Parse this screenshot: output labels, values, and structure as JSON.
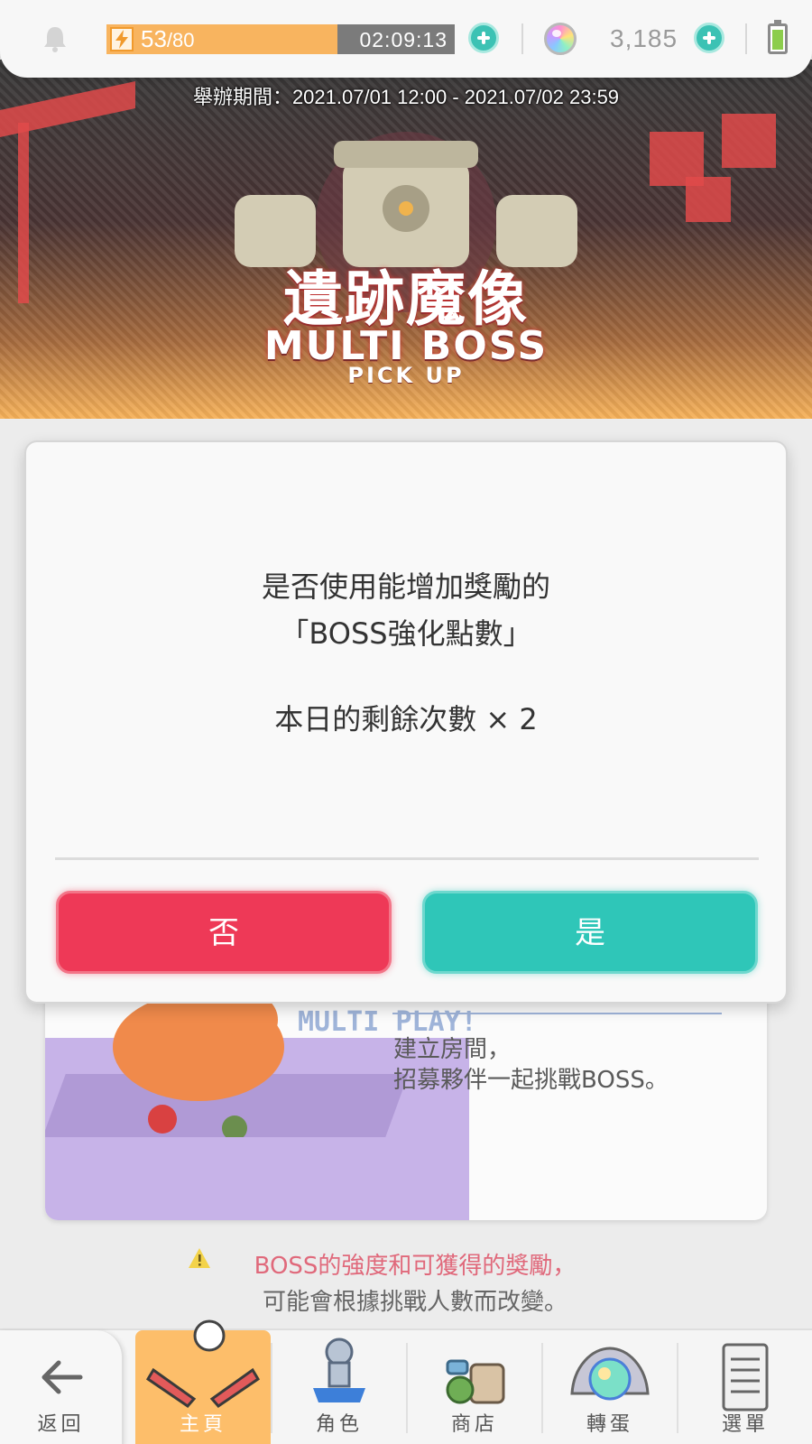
{
  "status_bar": {
    "stamina_current": "53",
    "stamina_max": "/80",
    "stamina_fraction": 0.6625,
    "stamina_timer": "02:09:13",
    "gem_count": "3,185"
  },
  "banner": {
    "period": "舉辦期間：2021.07/01 12:00 - 2021.07/02 23:59",
    "title": "遺跡魔像",
    "subtitle": "MULTI BOSS",
    "pickup": "PICK UP"
  },
  "modal": {
    "question_line1": "是否使用能增加獎勵的",
    "question_line2": "「BOSS強化點數」",
    "remaining": "本日的剩餘次數 × 2",
    "no_label": "否",
    "yes_label": "是"
  },
  "content_card": {
    "art_text": "MULTI PLAY!",
    "desc_line1": "建立房間，",
    "desc_line2": "招募夥伴一起挑戰BOSS。"
  },
  "warning": {
    "line1": "BOSS的強度和可獲得的獎勵，",
    "line2": "可能會根據挑戰人數而改變。"
  },
  "bottom_nav": {
    "back": "返回",
    "home": "主頁",
    "character": "角色",
    "shop": "商店",
    "gacha": "轉蛋",
    "menu": "選單"
  },
  "colors": {
    "stamina_fill": "#f8b45f",
    "no_button": "#ee3957",
    "yes_button": "#2fc6b8",
    "active_nav": "#fdbe6a",
    "warning_text": "#e0697b"
  }
}
